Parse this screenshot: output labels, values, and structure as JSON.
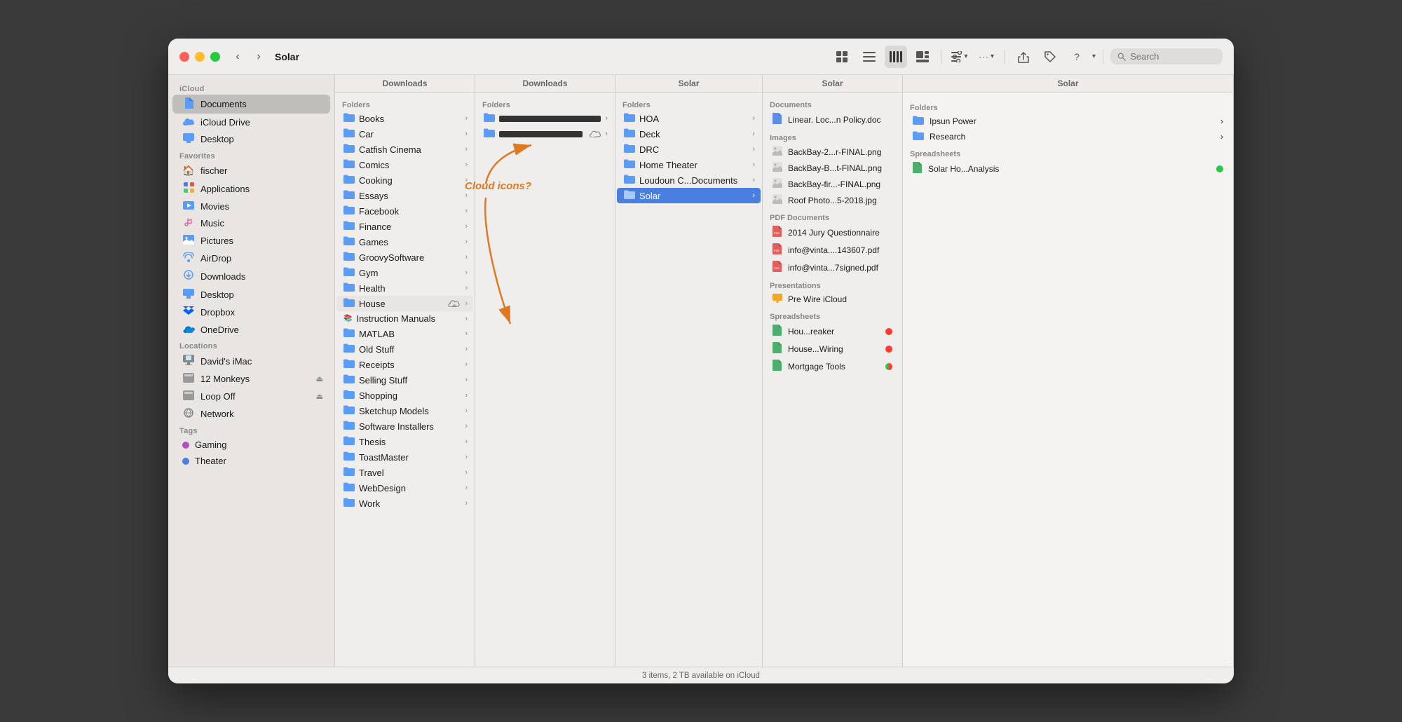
{
  "window": {
    "title": "Solar",
    "search_placeholder": "Search"
  },
  "toolbar": {
    "back": "‹",
    "forward": "›",
    "grid_icon": "⊞",
    "list_icon": "≡",
    "column_icon": "⫿",
    "gallery_icon": "▣",
    "view_options_icon": "⊞",
    "more_icon": "···",
    "share_icon": "↑",
    "tag_icon": "🏷",
    "help_icon": "?"
  },
  "sidebar": {
    "icloud_label": "iCloud",
    "icloud_items": [
      {
        "id": "documents",
        "label": "Documents",
        "icon": "📄",
        "active": true
      },
      {
        "id": "icloud-drive",
        "label": "iCloud Drive",
        "icon": "☁️"
      },
      {
        "id": "desktop",
        "label": "Desktop",
        "icon": "🖥"
      }
    ],
    "favorites_label": "Favorites",
    "favorites_items": [
      {
        "id": "fischer",
        "label": "fischer",
        "icon": "🏠"
      },
      {
        "id": "applications",
        "label": "Applications",
        "icon": "🚀"
      },
      {
        "id": "movies",
        "label": "Movies",
        "icon": "📺"
      },
      {
        "id": "music",
        "label": "Music",
        "icon": "🎵"
      },
      {
        "id": "pictures",
        "label": "Pictures",
        "icon": "🖼"
      },
      {
        "id": "airdrop",
        "label": "AirDrop",
        "icon": "📡"
      },
      {
        "id": "downloads",
        "label": "Downloads",
        "icon": "⬇"
      },
      {
        "id": "desktop2",
        "label": "Desktop",
        "icon": "🖥"
      },
      {
        "id": "dropbox",
        "label": "Dropbox",
        "icon": "📦"
      },
      {
        "id": "onedrive",
        "label": "OneDrive",
        "icon": "☁"
      }
    ],
    "locations_label": "Locations",
    "locations_items": [
      {
        "id": "davids-imac",
        "label": "David's iMac",
        "icon": "🖥",
        "eject": false
      },
      {
        "id": "12-monkeys",
        "label": "12 Monkeys",
        "icon": "💿",
        "eject": true
      },
      {
        "id": "loop-off",
        "label": "Loop Off",
        "icon": "💿",
        "eject": true
      },
      {
        "id": "network",
        "label": "Network",
        "icon": "🌐",
        "eject": false
      }
    ],
    "tags_label": "Tags",
    "tags_items": [
      {
        "id": "gaming",
        "label": "Gaming",
        "color": "#b44fbe"
      },
      {
        "id": "theater",
        "label": "Theater",
        "color": "#4a7fe0"
      }
    ]
  },
  "columns": {
    "col1_header": "Downloads",
    "col2_header": "Downloads",
    "col3_header": "Solar",
    "col4_header": "Solar",
    "col5_header": "Solar"
  },
  "col1_items": [
    {
      "name": "Books",
      "has_arrow": true
    },
    {
      "name": "Car",
      "has_arrow": true
    },
    {
      "name": "Catfish Cinema",
      "has_arrow": true
    },
    {
      "name": "Comics",
      "has_arrow": true
    },
    {
      "name": "Cooking",
      "has_arrow": true
    },
    {
      "name": "Essays",
      "has_arrow": true
    },
    {
      "name": "Facebook",
      "has_arrow": true
    },
    {
      "name": "Finance",
      "has_arrow": true
    },
    {
      "name": "Games",
      "has_arrow": true
    },
    {
      "name": "GroovySoftware",
      "has_arrow": true
    },
    {
      "name": "Gym",
      "has_arrow": true
    },
    {
      "name": "Health",
      "has_arrow": true
    },
    {
      "name": "House",
      "has_arrow": true,
      "cloud": true
    },
    {
      "name": "Instruction Manuals",
      "has_arrow": true
    },
    {
      "name": "MATLAB",
      "has_arrow": true
    },
    {
      "name": "Old Stuff",
      "has_arrow": true
    },
    {
      "name": "Receipts",
      "has_arrow": true
    },
    {
      "name": "Selling Stuff",
      "has_arrow": true
    },
    {
      "name": "Shopping",
      "has_arrow": true
    },
    {
      "name": "Sketchup Models",
      "has_arrow": true
    },
    {
      "name": "Software Installers",
      "has_arrow": true
    },
    {
      "name": "Thesis",
      "has_arrow": true
    },
    {
      "name": "ToastMaster",
      "has_arrow": true
    },
    {
      "name": "Travel",
      "has_arrow": true
    },
    {
      "name": "WebDesign",
      "has_arrow": true
    },
    {
      "name": "Work",
      "has_arrow": true
    }
  ],
  "col2_items": [
    {
      "name": "REDACTED1",
      "redacted": true,
      "has_arrow": true,
      "cloud": false
    },
    {
      "name": "REDACTED2",
      "redacted": true,
      "has_arrow": true,
      "cloud": true
    }
  ],
  "col3_items": [
    {
      "section": "Folders"
    },
    {
      "name": "HOA",
      "has_arrow": true
    },
    {
      "name": "Deck",
      "has_arrow": true
    },
    {
      "name": "DRC",
      "has_arrow": true
    },
    {
      "name": "Home Theater",
      "has_arrow": true
    },
    {
      "name": "Loudoun C...Documents",
      "has_arrow": true
    },
    {
      "name": "Solar",
      "has_arrow": true,
      "selected": true
    }
  ],
  "col4_items": [
    {
      "section": "Documents"
    },
    {
      "name": "Linear. Loc...n Policy.doc",
      "icon": "📄"
    },
    {
      "section": "Images"
    },
    {
      "name": "BackBay-2...r-FINAL.png",
      "icon": "🖼"
    },
    {
      "name": "BackBay-B...t-FINAL.png",
      "icon": "🖼"
    },
    {
      "name": "BackBay-fir...-FINAL.png",
      "icon": "🖼"
    },
    {
      "name": "Roof Photo...5-2018.jpg",
      "icon": "🖼"
    },
    {
      "section": "PDF Documents"
    },
    {
      "name": "2014 Jury Questionnaire",
      "icon": "📋"
    },
    {
      "name": "info@vinta....143607.pdf",
      "icon": "📋"
    },
    {
      "name": "info@vinta...7signed.pdf",
      "icon": "📋"
    },
    {
      "section": "Presentations"
    },
    {
      "name": "Pre Wire iCloud",
      "icon": "📊"
    },
    {
      "section": "Spreadsheets"
    },
    {
      "name": "Hou...reaker",
      "icon": "📊",
      "status": "red"
    },
    {
      "name": "House...Wiring",
      "icon": "📊",
      "status": "red"
    },
    {
      "name": "Mortgage Tools",
      "icon": "📊",
      "status": "half"
    }
  ],
  "col5_items": [
    {
      "section": "Folders"
    },
    {
      "name": "Ipsun Power",
      "has_arrow": true
    },
    {
      "name": "Research",
      "has_arrow": true
    },
    {
      "section": "Spreadsheets"
    },
    {
      "name": "Solar Ho...Analysis",
      "icon": "📊",
      "status": "green"
    }
  ],
  "annotation": {
    "text": "Cloud icons?",
    "color": "#e07820"
  },
  "status_bar": {
    "text": "3 items, 2 TB available on iCloud"
  }
}
